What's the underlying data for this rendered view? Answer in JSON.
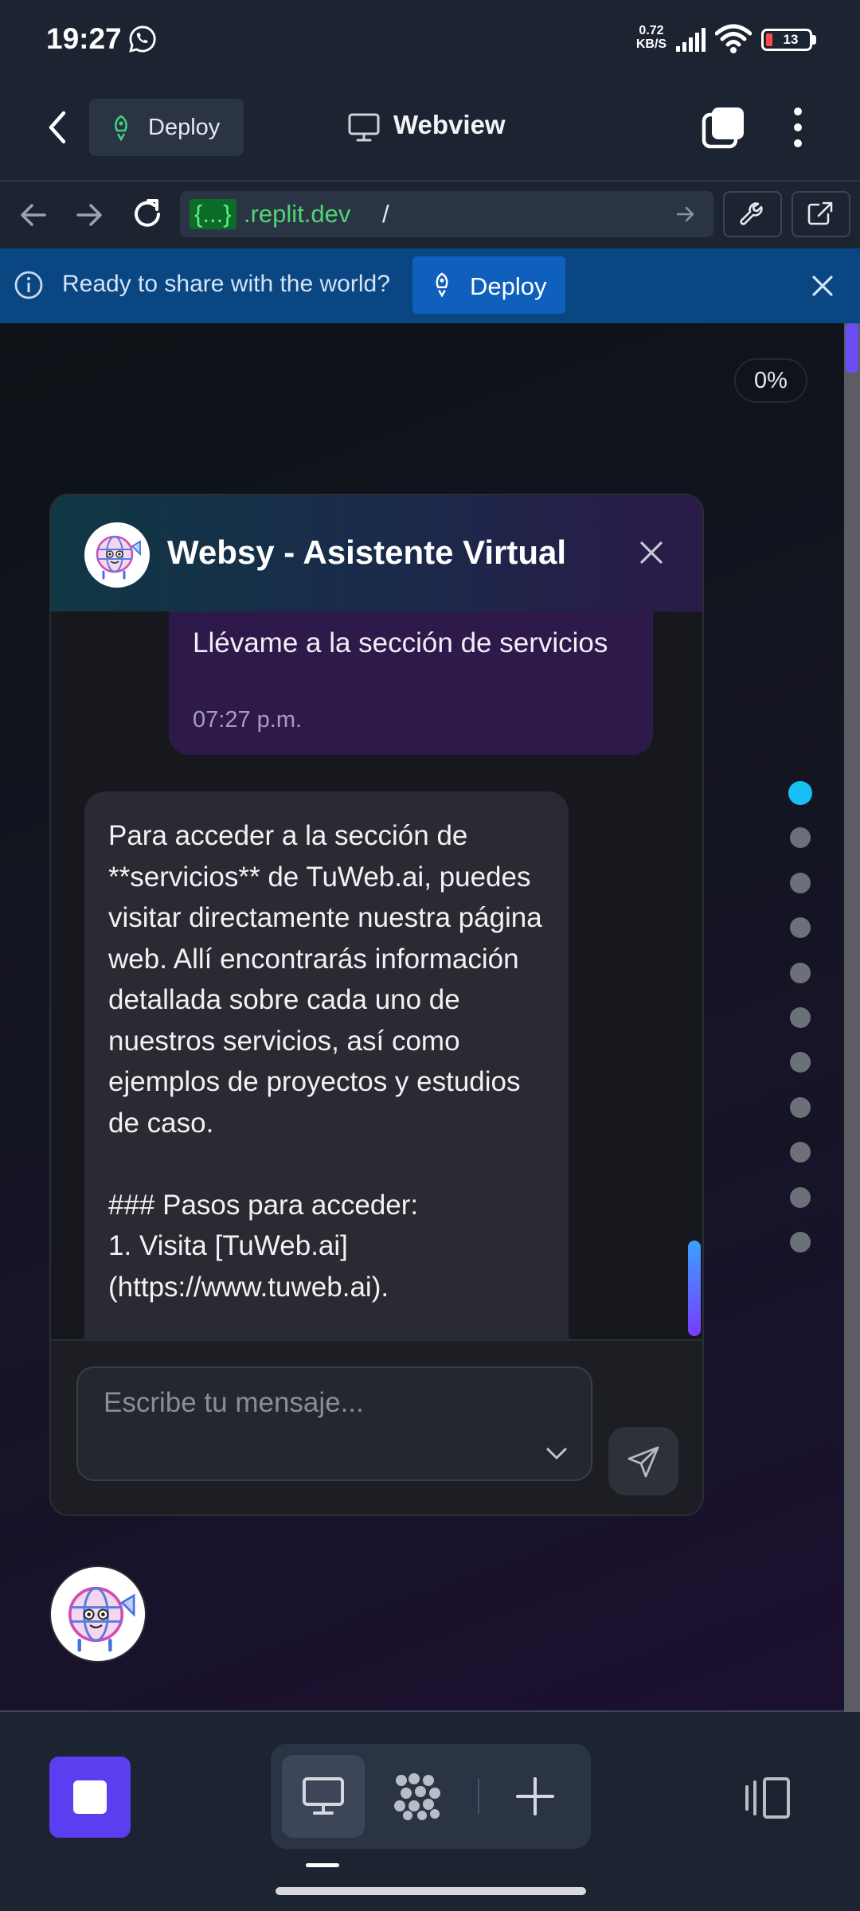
{
  "status_bar": {
    "time": "19:27",
    "net_speed_value": "0.72",
    "net_speed_unit": "KB/S",
    "battery_level": "13"
  },
  "header": {
    "deploy_label": "Deploy",
    "title": "Webview"
  },
  "url_bar": {
    "brace": "{...}",
    "domain": ".replit.dev",
    "path": "/"
  },
  "banner": {
    "text": "Ready to share with the world?",
    "deploy_label": "Deploy"
  },
  "page": {
    "scroll_percent": "0%",
    "section_dots": 11,
    "active_section_dot": 0
  },
  "chat": {
    "title": "Websy - Asistente Virtual",
    "user_message": {
      "text": "Llévame a la sección de servicios",
      "time": "07:27 p.m."
    },
    "bot_message": {
      "text": "Para acceder a la sección de **servicios** de TuWeb.ai, puedes visitar directamente nuestra página web. Allí encontrarás información detallada sobre cada uno de nuestros servicios, así como ejemplos de proyectos y estudios de caso.\n\n### Pasos para acceder:\n1. Visita [TuWeb.ai]\n(https://www.tuweb.ai)."
    },
    "input_placeholder": "Escribe tu mensaje..."
  },
  "colors": {
    "accent_purple": "#5a3ef0",
    "banner_blue": "#0a4682",
    "active_dot": "#18bff5",
    "url_green": "#4cd774"
  },
  "icons": [
    "whatsapp-icon",
    "signal-icon",
    "wifi-icon",
    "back-icon",
    "deploy-icon",
    "monitor-icon",
    "tabs-icon",
    "more-icon",
    "arrow-left-icon",
    "arrow-right-icon",
    "reload-icon",
    "wrench-icon",
    "external-link-icon",
    "info-icon",
    "close-icon",
    "send-icon",
    "chevron-down-icon",
    "grid-dots-icon",
    "plus-icon",
    "panel-toggle-icon"
  ]
}
